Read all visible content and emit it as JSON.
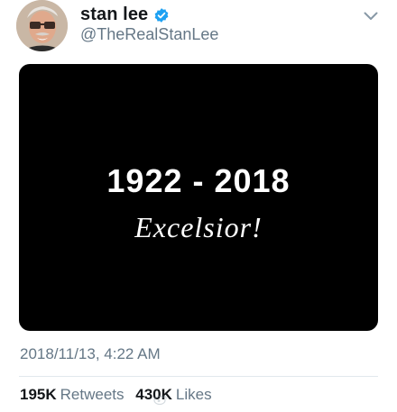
{
  "tweet": {
    "author": {
      "display_name": "stan lee",
      "handle": "@TheRealStanLee",
      "verified": true
    },
    "media": {
      "years": "1922 - 2018",
      "motto": "Excelsior!"
    },
    "timestamp": "2018/11/13, 4:22 AM",
    "stats": {
      "retweets_count": "195K",
      "retweets_label": "Retweets",
      "likes_count": "430K",
      "likes_label": "Likes"
    }
  },
  "icons": {
    "verified": "verified-badge-icon",
    "more": "chevron-down-icon"
  },
  "colors": {
    "verified_blue": "#1da1f2",
    "secondary_text": "#657786",
    "primary_text": "#14171a",
    "media_background": "#000000"
  }
}
